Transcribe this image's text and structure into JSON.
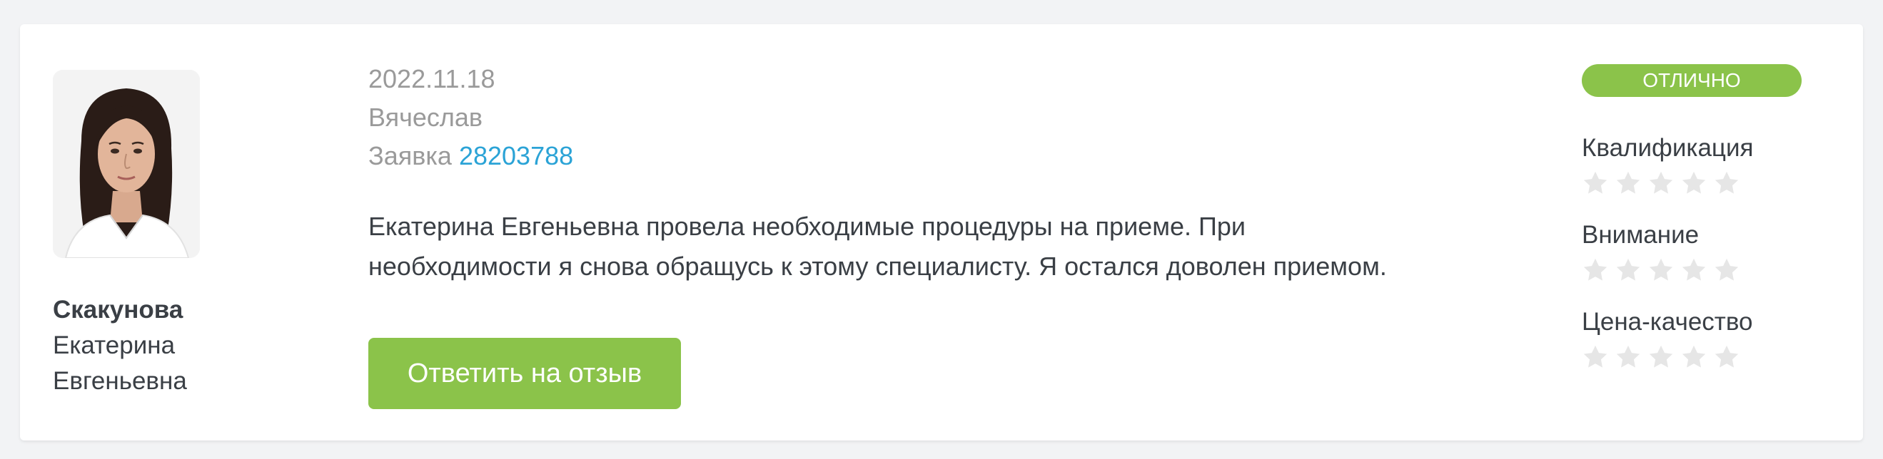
{
  "doctor": {
    "surname": "Скакунова",
    "first_name": "Екатерина",
    "patronymic": "Евгеньевна",
    "photo_icon": "doctor-photo"
  },
  "review": {
    "date": "2022.11.18",
    "author": "Вячеслав",
    "request_label": "Заявка",
    "request_number": "28203788",
    "text_line1": "Екатерина Евгеньевна провела необходимые процедуры на приеме. При",
    "text_line2": "необходимости я снова обращусь к этому специалисту. Я остался доволен приемом.",
    "reply_label": "Ответить на отзыв"
  },
  "verdict": {
    "label": "ОТЛИЧНО",
    "color": "#8bc34a"
  },
  "ratings": [
    {
      "label": "Квалификация",
      "stars_total": 5,
      "stars_filled": 0
    },
    {
      "label": "Внимание",
      "stars_total": 5,
      "stars_filled": 0
    },
    {
      "label": "Цена-качество",
      "stars_total": 5,
      "stars_filled": 0
    }
  ],
  "colors": {
    "accent": "#8bc34a",
    "link": "#2ba3d6",
    "star_empty": "#e6e6e6"
  }
}
